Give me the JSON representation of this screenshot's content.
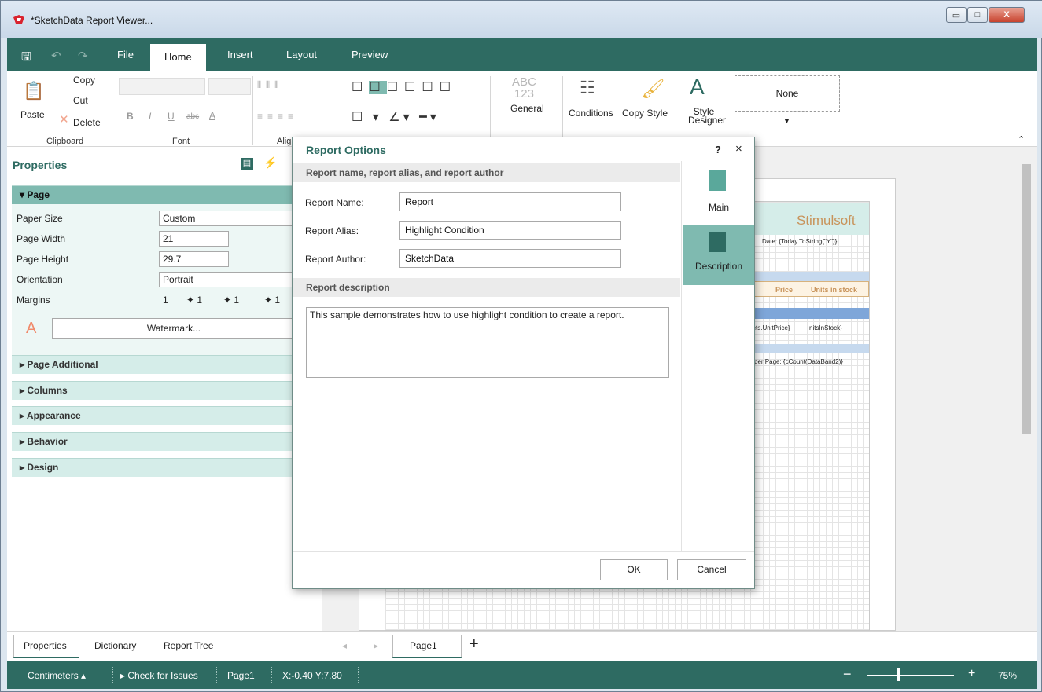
{
  "window": {
    "title": "*SketchData Report Viewer...",
    "controls": [
      "minimize",
      "maximize",
      "close"
    ]
  },
  "ribbon": {
    "tabs": [
      "File",
      "Home",
      "Insert",
      "Layout",
      "Preview"
    ],
    "active_tab": "Home",
    "clipboard": {
      "paste": "Paste",
      "copy": "Copy",
      "cut": "Cut",
      "delete": "Delete",
      "label": "Clipboard"
    },
    "font": {
      "label": "Font",
      "bold": "B",
      "italic": "I",
      "underline": "U",
      "strike": "abc",
      "color": "A"
    },
    "alignment": {
      "label": "Alig"
    },
    "format": {
      "sample": "ABC\n123",
      "name": "General"
    },
    "style": {
      "conditions": "Conditions",
      "copy_style": "Copy Style",
      "designer": "Style Designer",
      "style_name": "None"
    }
  },
  "properties": {
    "title": "Properties",
    "page_section": "Page",
    "rows": [
      {
        "label": "Paper Size",
        "value": "Custom"
      },
      {
        "label": "Page Width",
        "value": "21"
      },
      {
        "label": "Page Height",
        "value": "29.7"
      },
      {
        "label": "Orientation",
        "value": "Portrait"
      },
      {
        "label": "Margins",
        "value": "1"
      }
    ],
    "margins": [
      "1",
      "1",
      "1",
      "1"
    ],
    "watermark": "Watermark...",
    "sections": [
      "Page Additional",
      "Columns",
      "Appearance",
      "Behavior",
      "Design"
    ]
  },
  "report_preview": {
    "title": "Stimulsoft",
    "date": "Date: {Today.ToString(\"Y\")}",
    "col1": "Price",
    "col2": "Units in stock",
    "cell1": "cts.UnitPrice}",
    "cell2": "nitsInStock}",
    "footer": "per Page: {cCount(DataBand2)}"
  },
  "dialog": {
    "title": "Report Options",
    "help": "?",
    "close": "×",
    "header1": "Report name, report alias, and report author",
    "name_label": "Report Name:",
    "name": "Report",
    "alias_label": "Report Alias:",
    "alias": "Highlight Condition",
    "author_label": "Report Author:",
    "author": "SketchData",
    "header2": "Report description",
    "description": "This sample demonstrates how to use highlight condition to create a report.",
    "tabs": [
      "Main",
      "Description"
    ],
    "active_tab": "Description",
    "ok": "OK",
    "cancel": "Cancel"
  },
  "bottom_tabs": [
    "Properties",
    "Dictionary",
    "Report Tree"
  ],
  "page_tab": "Page1",
  "status": {
    "units": "Centimeters",
    "check": "Check for Issues",
    "page": "Page1",
    "coords": "X:-0.40 Y:7.80",
    "zoom": "75%"
  },
  "colors": {
    "accent": "#2e6b62",
    "section": "#d5ede9",
    "section_open": "#7fbab0"
  }
}
